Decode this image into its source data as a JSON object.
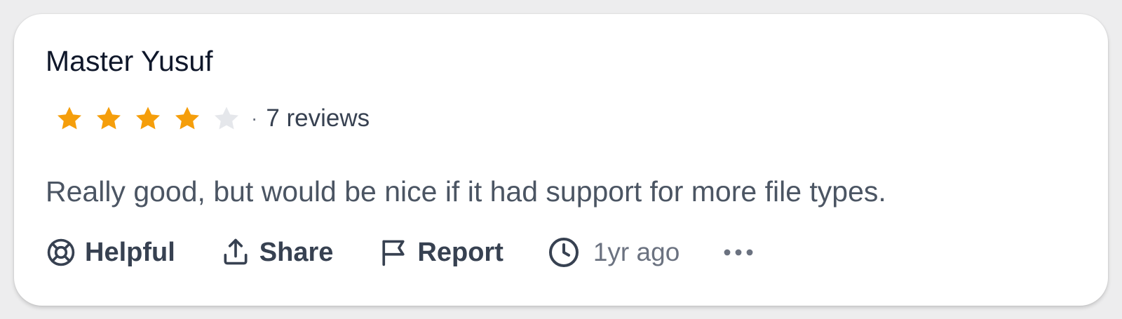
{
  "review": {
    "author": "Master Yusuf",
    "rating": 4,
    "max_rating": 5,
    "rating_separator": "·",
    "review_count": "7 reviews",
    "body": "Really good, but would be nice if it had support for more file types.",
    "time_ago": "1yr ago"
  },
  "actions": {
    "helpful_label": "Helpful",
    "share_label": "Share",
    "report_label": "Report"
  },
  "icons": {
    "helpful": "lifebuoy-icon",
    "share": "share-upload-icon",
    "report": "flag-icon",
    "time": "clock-icon",
    "more": "more-horizontal-icon",
    "star": "star-icon"
  },
  "colors": {
    "star_filled": "#f59e0b",
    "star_empty": "#e5e7eb",
    "text_primary": "#0f172a",
    "text_secondary": "#4b5563",
    "text_muted": "#6b7280"
  }
}
